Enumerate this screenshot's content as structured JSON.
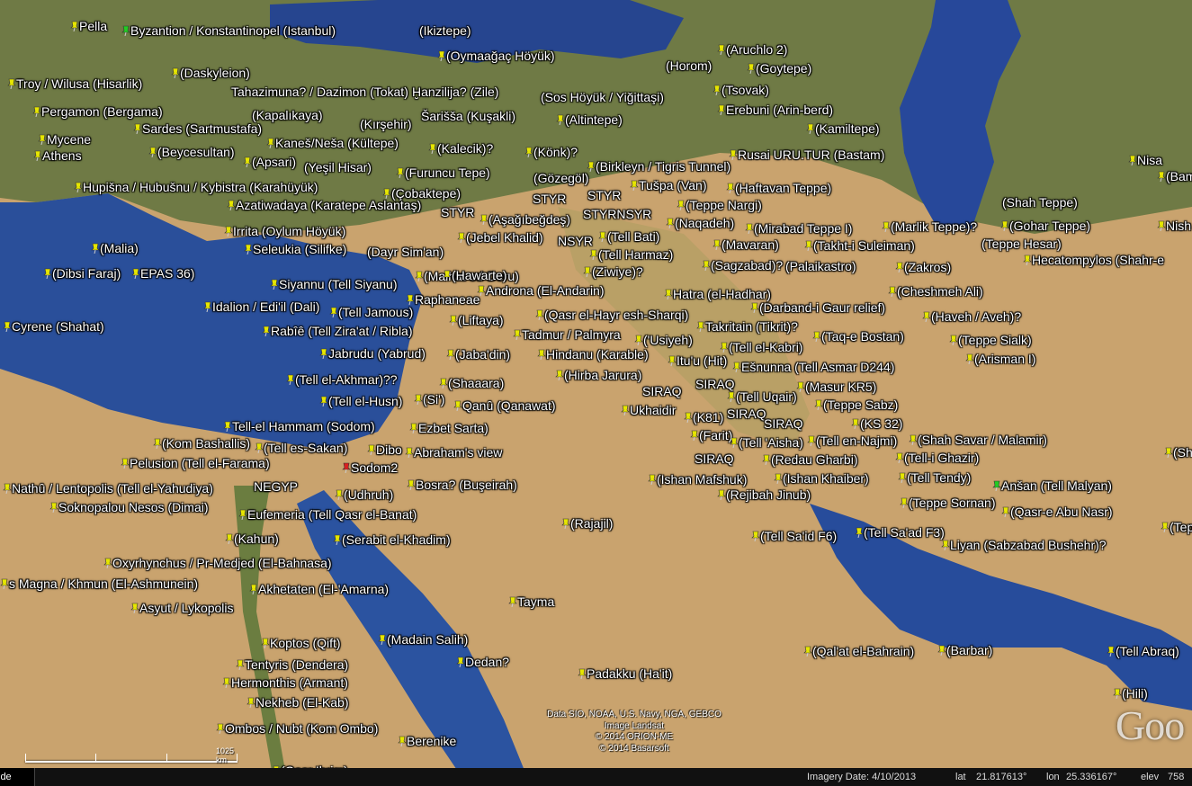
{
  "colors": {
    "sea": "#2a4f9a",
    "land": "#c9a36e",
    "pin_yellow": "#e6e600",
    "pin_green": "#22cc22",
    "label": "#ffffff"
  },
  "places": [
    {
      "t": "Pella",
      "p": "yellow"
    },
    {
      "t": "Byzantion / Konstantinopel (Istanbul)",
      "p": "green"
    },
    {
      "t": "(Ikiztepe)",
      "p": "none"
    },
    {
      "t": "(Oymaağaç Höyük)",
      "p": "yellow"
    },
    {
      "t": "(Aruchlo 2)",
      "p": "yellow"
    },
    {
      "t": "(Horom)",
      "p": "none"
    },
    {
      "t": "(Goytepe)",
      "p": "yellow"
    },
    {
      "t": "(Daskyleion)",
      "p": "yellow"
    },
    {
      "t": "Troy / Wilusa (Hisarlik)",
      "p": "yellow"
    },
    {
      "t": "Tahazimuna? / Dazimon (Tokat)",
      "p": "none"
    },
    {
      "t": "Ḫanzilija? (Zile)",
      "p": "none"
    },
    {
      "t": "(Sos Höyük / Yiğittaşi)",
      "p": "none"
    },
    {
      "t": "(Tsovak)",
      "p": "yellow"
    },
    {
      "t": "Erebuni (Arin-berd)",
      "p": "yellow"
    },
    {
      "t": "Pergamon (Bergama)",
      "p": "yellow"
    },
    {
      "t": "(Kapalıkaya)",
      "p": "none"
    },
    {
      "t": "Šarišša (Kuşakli)",
      "p": "none"
    },
    {
      "t": "(Kırşehir)",
      "p": "none"
    },
    {
      "t": "(Altintepe)",
      "p": "yellow"
    },
    {
      "t": "(Kamiltepe)",
      "p": "yellow"
    },
    {
      "t": "Sardes (Sartmustafa)",
      "p": "yellow"
    },
    {
      "t": "Mycene",
      "p": "yellow"
    },
    {
      "t": "Kaneš/Neša (Kültepe)",
      "p": "yellow"
    },
    {
      "t": "(Kalecik)?",
      "p": "yellow"
    },
    {
      "t": "(Könk)?",
      "p": "yellow"
    },
    {
      "t": "(Beycesultan)",
      "p": "yellow"
    },
    {
      "t": "Athens",
      "p": "yellow"
    },
    {
      "t": "(Apsari)",
      "p": "yellow"
    },
    {
      "t": "Rusai URU.TUR (Bastam)",
      "p": "yellow"
    },
    {
      "t": "(Yeşil Hisar)",
      "p": "none"
    },
    {
      "t": "(Furuncu Tepe)",
      "p": "yellow"
    },
    {
      "t": "(Birkleyn / Tigris Tunnel)",
      "p": "yellow"
    },
    {
      "t": "(Gözegöl)",
      "p": "none"
    },
    {
      "t": "Tušpa (Van)",
      "p": "yellow"
    },
    {
      "t": "Nisa",
      "p": "yellow"
    },
    {
      "t": "(Bam",
      "p": "yellow"
    },
    {
      "t": "Hupišna / Hubušnu / Kybistra (Karahüyük)",
      "p": "yellow"
    },
    {
      "t": "(Çobaktepe)",
      "p": "yellow"
    },
    {
      "t": "STYR",
      "p": "none"
    },
    {
      "t": "STYR",
      "p": "none"
    },
    {
      "t": "(Haftavan Teppe)",
      "p": "yellow"
    },
    {
      "t": "Azatiwadaya (Karatepe Aslantaş)",
      "p": "yellow"
    },
    {
      "t": "(Teppe Nargi)",
      "p": "yellow"
    },
    {
      "t": "(Shah Teppe)",
      "p": "none"
    },
    {
      "t": "STYR",
      "p": "none"
    },
    {
      "t": "(Aşağıbeğdeş)",
      "p": "yellow"
    },
    {
      "t": "STYRNSYR",
      "p": "none"
    },
    {
      "t": "(Naqadeh)",
      "p": "yellow"
    },
    {
      "t": "(Mirabad Teppe I)",
      "p": "yellow"
    },
    {
      "t": "(Marlik Teppe)?",
      "p": "yellow"
    },
    {
      "t": "(Gohar Teppe)",
      "p": "yellow"
    },
    {
      "t": "Nish",
      "p": "yellow"
    },
    {
      "t": "Irrita (Oylum Höyük)",
      "p": "yellow"
    },
    {
      "t": "(Jebel Khalid)",
      "p": "yellow"
    },
    {
      "t": "NSYR",
      "p": "none"
    },
    {
      "t": "(Tell Bati)",
      "p": "yellow"
    },
    {
      "t": "(Mavaran)",
      "p": "yellow"
    },
    {
      "t": "(Takht-i Suleiman)",
      "p": "yellow"
    },
    {
      "t": "(Teppe Hesar)",
      "p": "none"
    },
    {
      "t": "Seleukia (Silifke)",
      "p": "yellow"
    },
    {
      "t": "(Dayr Sim'an)",
      "p": "none"
    },
    {
      "t": "(Tell Harmaz)",
      "p": "yellow"
    },
    {
      "t": "Hecatompylos (Shahr-e",
      "p": "yellow"
    },
    {
      "t": "(Malia)",
      "p": "yellow"
    },
    {
      "t": "(Dibsi Faraj)",
      "p": "yellow"
    },
    {
      "t": "EPAS 36)",
      "p": "yellow"
    },
    {
      "t": "(Ziwiye)?",
      "p": "yellow"
    },
    {
      "t": "(Sagzabad)?",
      "p": "yellow"
    },
    {
      "t": "(Palaikastro)",
      "p": "none"
    },
    {
      "t": "(Zakros)",
      "p": "yellow"
    },
    {
      "t": "(Malhat ed-Deru)",
      "p": "yellow"
    },
    {
      "t": "(Hawarte)",
      "p": "yellow"
    },
    {
      "t": "Siyannu (Tell Siyanu)",
      "p": "yellow"
    },
    {
      "t": "Androna (El-Andarin)",
      "p": "yellow"
    },
    {
      "t": "Hatra (el-Hadhar)",
      "p": "yellow"
    },
    {
      "t": "(Cheshmeh Ali)",
      "p": "yellow"
    },
    {
      "t": "Raphaneae",
      "p": "yellow"
    },
    {
      "t": "Idalion / Edi'il (Dali)",
      "p": "yellow"
    },
    {
      "t": "(Darband-i Gaur relief)",
      "p": "yellow"
    },
    {
      "t": "(Tell Jamous)",
      "p": "yellow"
    },
    {
      "t": "(Qasr el-Hayr esh-Sharqi)",
      "p": "yellow"
    },
    {
      "t": "(Haveh / Aveh)?",
      "p": "yellow"
    },
    {
      "t": "(Liftaya)",
      "p": "yellow"
    },
    {
      "t": "Cyrene (Shahat)",
      "p": "yellow"
    },
    {
      "t": "Takritain (Tikrit)?",
      "p": "yellow"
    },
    {
      "t": "Rabîê (Tell Zira'at / Ribla)",
      "p": "yellow"
    },
    {
      "t": "Tadmur / Palmyra",
      "p": "yellow"
    },
    {
      "t": "('Usiyeh)",
      "p": "yellow"
    },
    {
      "t": "(Taq-e Bostan)",
      "p": "yellow"
    },
    {
      "t": "(Teppe Sialk)",
      "p": "yellow"
    },
    {
      "t": "(Tell el-Kabri)",
      "p": "yellow"
    },
    {
      "t": "Jabrudu (Yabrud)",
      "p": "yellow"
    },
    {
      "t": "(Jaba'din)",
      "p": "yellow"
    },
    {
      "t": "Hindanu (Karable)",
      "p": "yellow"
    },
    {
      "t": "Itu'u (Hit)",
      "p": "yellow"
    },
    {
      "t": "(Arisman I)",
      "p": "yellow"
    },
    {
      "t": "Ešnunna (Tell Asmar D244)",
      "p": "yellow"
    },
    {
      "t": "(Tell el-Akhmar)??",
      "p": "yellow"
    },
    {
      "t": "(Shaaara)",
      "p": "yellow"
    },
    {
      "t": "(Hirba Jarura)",
      "p": "yellow"
    },
    {
      "t": "SIRAQ",
      "p": "none"
    },
    {
      "t": "(Masur KR5)",
      "p": "yellow"
    },
    {
      "t": "SIRAQ",
      "p": "none"
    },
    {
      "t": "(Tell Uqair)",
      "p": "yellow"
    },
    {
      "t": "(Tell el-Husn)",
      "p": "yellow"
    },
    {
      "t": "(Si')",
      "p": "yellow"
    },
    {
      "t": "Qanû (Qanawat)",
      "p": "yellow"
    },
    {
      "t": "(Teppe Sabz)",
      "p": "yellow"
    },
    {
      "t": "Ukhaidir",
      "p": "yellow"
    },
    {
      "t": "(K81)",
      "p": "yellow"
    },
    {
      "t": "SIRAQ",
      "p": "none"
    },
    {
      "t": "SIRAQ",
      "p": "none"
    },
    {
      "t": "(KS 32)",
      "p": "yellow"
    },
    {
      "t": "Tell-el Hammam (Sodom)",
      "p": "yellow"
    },
    {
      "t": "Ezbet Sarta)",
      "p": "yellow"
    },
    {
      "t": "(Farit)",
      "p": "yellow"
    },
    {
      "t": "(Tell 'Aisha)",
      "p": "yellow"
    },
    {
      "t": "(Tell en-Najmi)",
      "p": "yellow"
    },
    {
      "t": "(Shah Savar / Malamir)",
      "p": "yellow"
    },
    {
      "t": "(Kom Bashallis)",
      "p": "yellow"
    },
    {
      "t": "(Tell es-Sakan)",
      "p": "yellow"
    },
    {
      "t": "Dibo",
      "p": "yellow"
    },
    {
      "t": "Abraham's view",
      "p": "yellow"
    },
    {
      "t": "SIRAQ",
      "p": "none"
    },
    {
      "t": "(Redau Gharbi)",
      "p": "yellow"
    },
    {
      "t": "(Tell-i Ghazir)",
      "p": "yellow"
    },
    {
      "t": "(Sha",
      "p": "yellow"
    },
    {
      "t": "Pelusion (Tell el-Farama)",
      "p": "yellow"
    },
    {
      "t": "Sodom2",
      "p": "red"
    },
    {
      "t": "(Ishan Mafshuk)",
      "p": "yellow"
    },
    {
      "t": "(Ishan Khaiber)",
      "p": "yellow"
    },
    {
      "t": "(Tell Tendy)",
      "p": "yellow"
    },
    {
      "t": "Anšan (Tell Malyan)",
      "p": "green"
    },
    {
      "t": "Nathû / Lentopolis (Tell el-Yahudiya)",
      "p": "yellow"
    },
    {
      "t": "NEGYP",
      "p": "none"
    },
    {
      "t": "Bosra? (Buşeirah)",
      "p": "yellow"
    },
    {
      "t": "(Udhruh)",
      "p": "yellow"
    },
    {
      "t": "(Rejibah Jinub)",
      "p": "yellow"
    },
    {
      "t": "(Teppe Sornan)",
      "p": "yellow"
    },
    {
      "t": "(Qasr-e Abu Nasr)",
      "p": "yellow"
    },
    {
      "t": "Soknopalou Nesos (Dimai)",
      "p": "yellow"
    },
    {
      "t": "Eufemeria (Tell Qasr el-Banat)",
      "p": "yellow"
    },
    {
      "t": "(Rajajil)",
      "p": "yellow"
    },
    {
      "t": "(Tell Sa'ad F3)",
      "p": "yellow"
    },
    {
      "t": "(Teppe",
      "p": "yellow"
    },
    {
      "t": "(Tell Sa'id F6)",
      "p": "yellow"
    },
    {
      "t": "(Kahun)",
      "p": "yellow"
    },
    {
      "t": "(Serabit el-Khadim)",
      "p": "yellow"
    },
    {
      "t": "Liyan (Sabzabad Bushehr)?",
      "p": "yellow"
    },
    {
      "t": "Oxyrhynchus / Pr-Medjed (El-Bahnasa)",
      "p": "yellow"
    },
    {
      "t": "s Magna / Khmun (El-Ashmunein)",
      "p": "yellow"
    },
    {
      "t": "Akhetaten (El-'Amarna)",
      "p": "yellow"
    },
    {
      "t": "Tayma",
      "p": "yellow"
    },
    {
      "t": "Asyut / Lykopolis",
      "p": "yellow"
    },
    {
      "t": "(Madain Salih)",
      "p": "yellow"
    },
    {
      "t": "Koptos (Qift)",
      "p": "yellow"
    },
    {
      "t": "(Qal'at el-Bahrain)",
      "p": "yellow"
    },
    {
      "t": "(Barbar)",
      "p": "yellow"
    },
    {
      "t": "(Tell Abraq)",
      "p": "yellow"
    },
    {
      "t": "Dedan?",
      "p": "yellow"
    },
    {
      "t": "Tentyris (Dendera)",
      "p": "yellow"
    },
    {
      "t": "Padakku (Ha'it)",
      "p": "yellow"
    },
    {
      "t": "Hermonthis (Armant)",
      "p": "yellow"
    },
    {
      "t": "(Hili)",
      "p": "yellow"
    },
    {
      "t": "Nekheb (El-Kab)",
      "p": "yellow"
    },
    {
      "t": "Ombos / Nubt (Kom Ombo)",
      "p": "yellow"
    },
    {
      "t": "Berenike",
      "p": "yellow"
    },
    {
      "t": "(Qasr Ibrim)",
      "p": "yellow"
    }
  ],
  "attribution": [
    "Data SIO, NOAA, U.S. Navy, NGA, GEBCO",
    "Image Landsat",
    "© 2014 ORION-ME",
    "© 2014 Basarsoft"
  ],
  "logo": "Goo",
  "scale": {
    "label": "1025 km"
  },
  "status": {
    "sidebar_tab": "ide",
    "imagery_date": "Imagery Date: 4/10/2013",
    "lat_label": "lat",
    "lat_value": "21.817613°",
    "lon_label": "lon",
    "lon_value": "25.336167°",
    "elev_label": "elev",
    "elev_value": "758"
  }
}
